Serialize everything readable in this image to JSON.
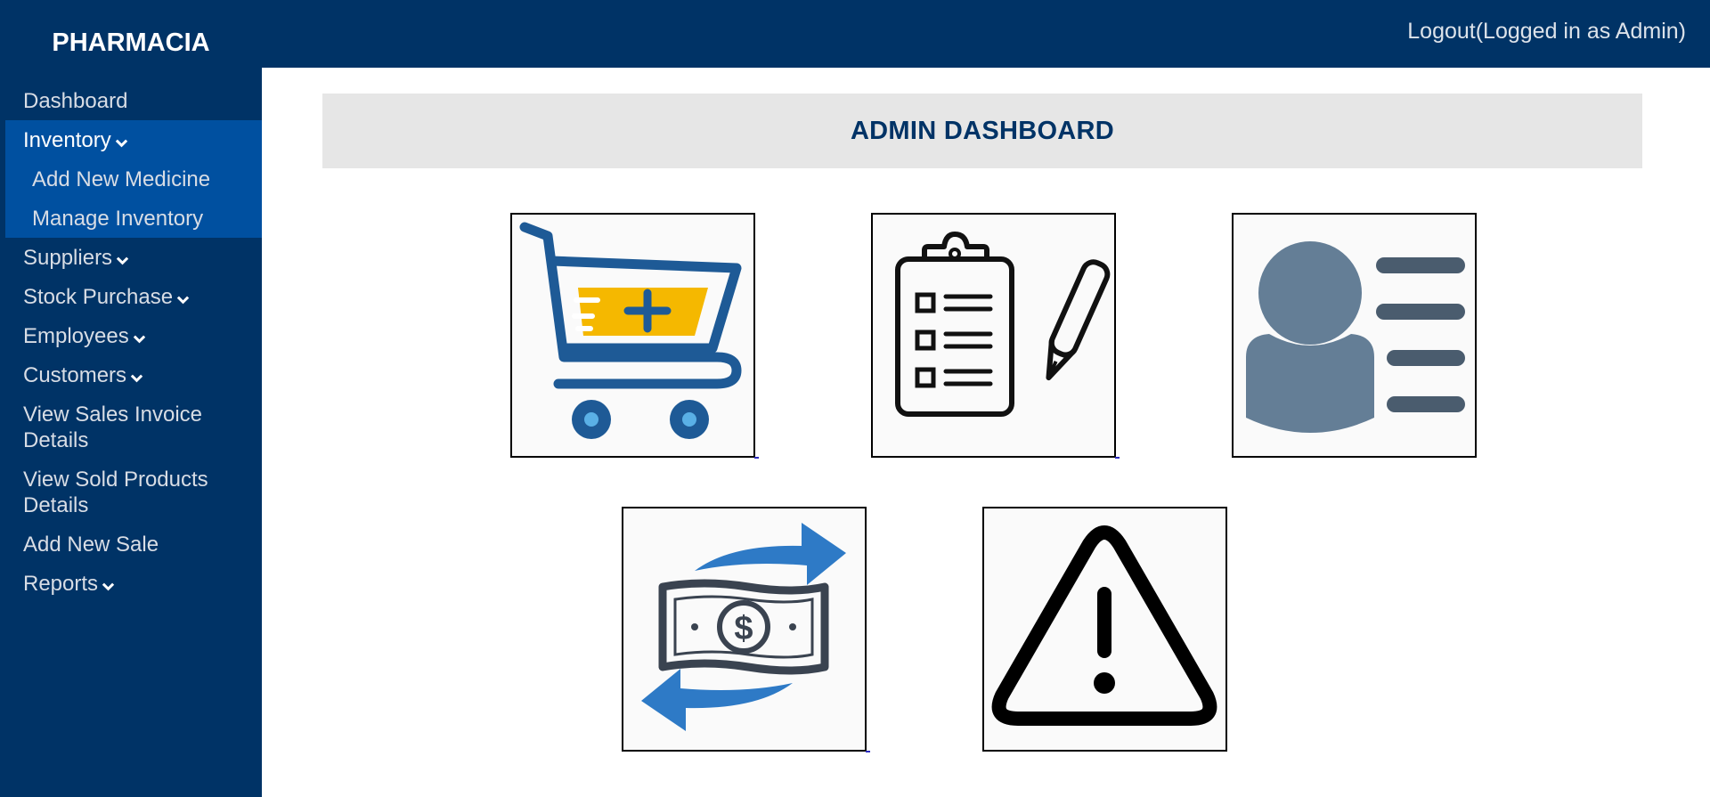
{
  "brand": "PHARMACIA",
  "logout_label": "Logout(Logged in as Admin)",
  "title": "ADMIN DASHBOARD",
  "sidebar": {
    "dashboard": "Dashboard",
    "inventory": "Inventory",
    "inventory_sub": [
      "Add New Medicine",
      "Manage Inventory"
    ],
    "suppliers": "Suppliers",
    "stock_purchase": "Stock Purchase",
    "employees": "Employees",
    "customers": "Customers",
    "view_sales_invoice": [
      "View Sales Invoice",
      "Details"
    ],
    "view_sold_products": [
      "View Sold Products",
      "Details"
    ],
    "add_new_sale": "Add New Sale",
    "reports": "Reports"
  },
  "colors": {
    "nav_bg": "#003366",
    "nav_active_bg": "#0050a0",
    "header_bg": "#e6e6e6",
    "title_color": "#003366"
  },
  "tiles": [
    {
      "icon": "shopping-cart-add-icon"
    },
    {
      "icon": "clipboard-checklist-pen-icon"
    },
    {
      "icon": "user-profile-card-icon"
    },
    {
      "icon": "money-exchange-icon"
    },
    {
      "icon": "warning-triangle-icon"
    }
  ]
}
